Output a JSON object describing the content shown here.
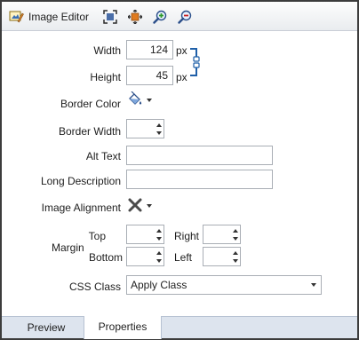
{
  "toolbar": {
    "title": "Image Editor",
    "icons": [
      "image-editor-icon",
      "fit-image-icon",
      "actual-size-icon",
      "zoom-in-icon",
      "zoom-out-icon"
    ]
  },
  "fields": {
    "width_label": "Width",
    "width_value": "124",
    "width_unit": "px",
    "height_label": "Height",
    "height_value": "45",
    "height_unit": "px",
    "border_color_label": "Border Color",
    "border_width_label": "Border Width",
    "alt_text_label": "Alt Text",
    "alt_text_value": "",
    "long_description_label": "Long Description",
    "long_description_value": "",
    "image_alignment_label": "Image Alignment",
    "margin_label": "Margin",
    "margin_top_label": "Top",
    "margin_right_label": "Right",
    "margin_bottom_label": "Bottom",
    "margin_left_label": "Left",
    "css_class_label": "CSS Class",
    "css_class_value": "Apply Class"
  },
  "tabs": [
    {
      "label": "Preview",
      "active": false
    },
    {
      "label": "Properties",
      "active": true
    }
  ],
  "colors": {
    "toolbar_icon_blue": "#2b4f8a",
    "zoom_in_green": "#2f9a2f",
    "zoom_out_red": "#c8201f",
    "lock_blue": "#1f5fa8",
    "tab_strip": "#dde4ee"
  }
}
